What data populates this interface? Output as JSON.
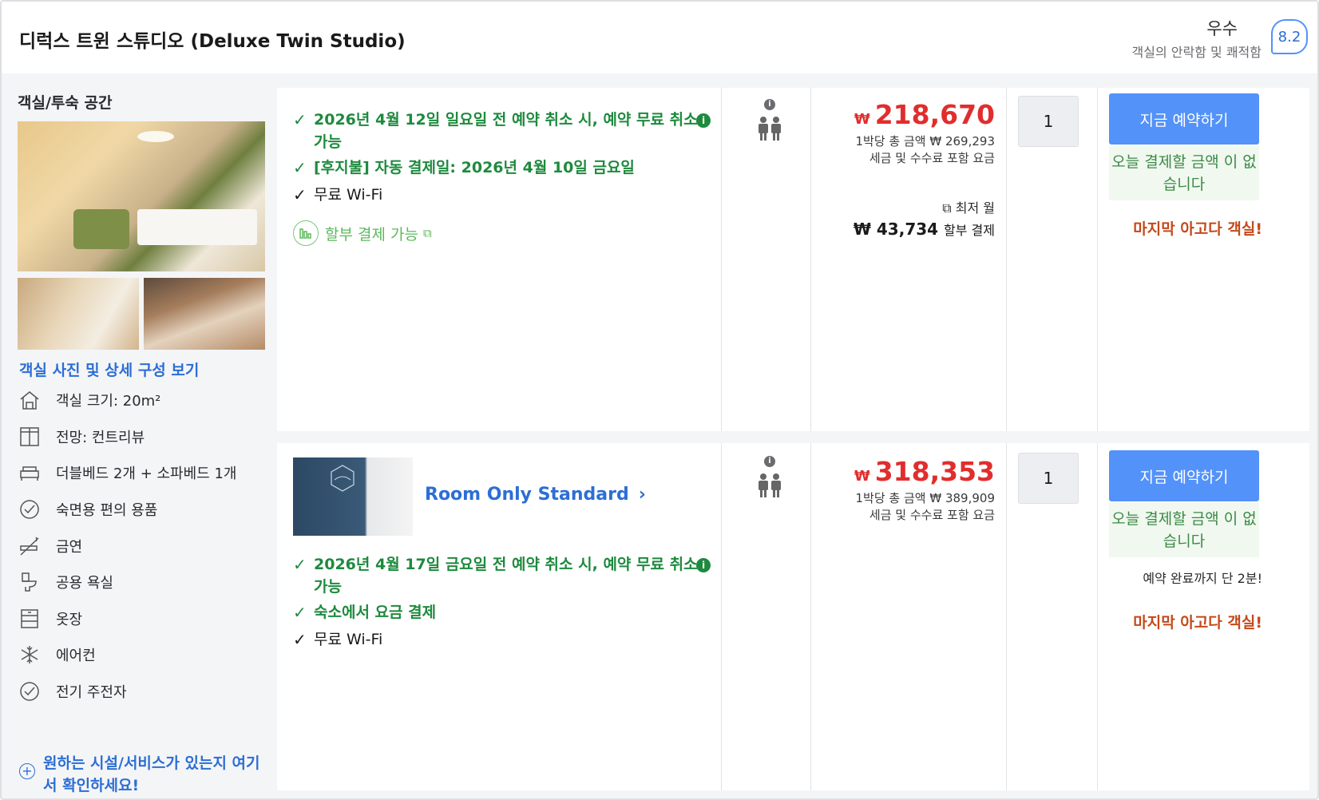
{
  "header": {
    "room_title": "디럭스 트윈 스튜디오 (Deluxe Twin Studio)",
    "rating_word": "우수",
    "rating_sub": "객실의 안락함 및 쾌적함",
    "score": "8.2"
  },
  "left": {
    "section_title": "객실/투숙 공간",
    "photo_link": "객실 사진 및 상세 구성 보기",
    "amenities": [
      {
        "icon": "house-icon",
        "label": "객실 크기: 20m²"
      },
      {
        "icon": "window-icon",
        "label": "전망: 컨트리뷰"
      },
      {
        "icon": "bed-icon",
        "label": "더블베드 2개 + 소파베드 1개"
      },
      {
        "icon": "check-circle-icon",
        "label": "숙면용 편의 용품"
      },
      {
        "icon": "no-smoking-icon",
        "label": "금연"
      },
      {
        "icon": "toilet-icon",
        "label": "공용 욕실"
      },
      {
        "icon": "wardrobe-icon",
        "label": "옷장"
      },
      {
        "icon": "snowflake-icon",
        "label": "에어컨"
      },
      {
        "icon": "check-circle-icon",
        "label": "전기 주전자"
      }
    ],
    "more_link": "원하는 시설/서비스가 있는지 여기서 확인하세요!"
  },
  "offers": [
    {
      "benefits": [
        {
          "text": "2026년 4월 12일 일요일 전 예약 취소 시, 예약 무료 취소 가능",
          "style": "green"
        },
        {
          "text": "[후지불] 자동 결제일: 2026년 4월 10일 금요일",
          "style": "green"
        },
        {
          "text": "무료 Wi-Fi",
          "style": "plain"
        }
      ],
      "installment_label": "할부 결제 가능",
      "currency": "₩",
      "price": "218,670",
      "price_total": "1박당 총 금액 ₩ 269,293",
      "price_tax": "세금 및 수수료 포함 요금",
      "min_label": "최저 월",
      "installment_price": "₩ 43,734",
      "installment_suffix": "할부 결제",
      "quantity": "1",
      "book_label": "지금 예약하기",
      "pay_note": "오늘 결제할 금액 이 없습니다",
      "urgency": "마지막 아고다 객실!"
    },
    {
      "room_name": "Room Only Standard",
      "benefits": [
        {
          "text": "2026년 4월 17일 금요일 전 예약 취소 시, 예약 무료 취소 가능",
          "style": "green"
        },
        {
          "text": "숙소에서 요금 결제",
          "style": "green"
        },
        {
          "text": "무료 Wi-Fi",
          "style": "plain"
        }
      ],
      "currency": "₩",
      "price": "318,353",
      "price_total": "1박당 총 금액 ₩ 389,909",
      "price_tax": "세금 및 수수료 포함 요금",
      "quantity": "1",
      "book_label": "지금 예약하기",
      "pay_note": "오늘 결제할 금액 이 없습니다",
      "time_left": "예약 완료까지 단 2분!",
      "urgency": "마지막 아고다 객실!"
    }
  ],
  "colors": {
    "accent_blue": "#5392f9",
    "link_blue": "#2c6ed4",
    "price_red": "#e12d2d",
    "benefit_green": "#1e8a3e",
    "urgency_orange": "#c4491a"
  }
}
